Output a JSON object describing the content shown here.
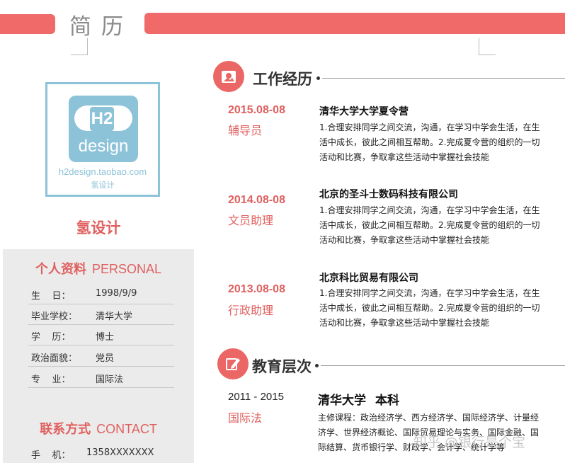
{
  "header": {
    "title": "简历"
  },
  "profile": {
    "logo": {
      "url_text": "h2design.taobao.com",
      "cn_text": "氢设计",
      "mark": "H2",
      "word": "design"
    },
    "name": "氢设计"
  },
  "personal": {
    "heading_cn": "个人资料",
    "heading_en": "PERSONAL",
    "rows": [
      {
        "label": "生    日：",
        "value": "1998/9/9"
      },
      {
        "label": "毕业学校：",
        "value": "清华大学"
      },
      {
        "label": "学    历：",
        "value": "博士"
      },
      {
        "label": "政治面貌：",
        "value": "党员"
      },
      {
        "label": "专    业：",
        "value": "国际法"
      }
    ]
  },
  "contact": {
    "heading_cn": "联系方式",
    "heading_en": "CONTACT",
    "rows": [
      {
        "label": "手    机：",
        "value": "1358XXXXXXX"
      }
    ]
  },
  "work": {
    "heading": "工作经历",
    "items": [
      {
        "date": "2015.08-08",
        "role": "辅导员",
        "company": "清华大学大学夏令营",
        "desc": "1.合理安排同学之间交流，沟通，在学习中学会生活，在生活中成长，彼此之间相互帮助。2.完成夏令营的组织的一切活动和比赛，争取拿这些活动中掌握社会技能"
      },
      {
        "date": "2014.08-08",
        "role": "文员助理",
        "company": "北京的圣斗士数码科技有限公司",
        "desc": "1.合理安排同学之间交流，沟通，在学习中学会生活，在生活中成长，彼此之间相互帮助。2.完成夏令营的组织的一切活动和比赛，争取拿这些活动中掌握社会技能"
      },
      {
        "date": "2013.08-08",
        "role": "行政助理",
        "company": "北京科比贸易有限公司",
        "desc": "1.合理安排同学之间交流，沟通，在学习中学会生活，在生活中成长，彼此之间相互帮助。2.完成夏令营的组织的一切活动和比赛，争取拿这些活动中掌握社会技能"
      }
    ]
  },
  "education": {
    "heading": "教育层次",
    "years": "2011 - 2015",
    "major": "国际法",
    "school": "清华大学",
    "degree": "本科",
    "desc": "主修课程：政治经济学、西方经济学、国际经济学、计量经济学、世界经济概论、国际贸易理论与实务、国际金融、国际结算、货币银行学、财政学、会计学、统计学等"
  },
  "watermark": "知乎 @银行是个宝",
  "colors": {
    "accent": "#f06a6a",
    "heading_red": "#e0605f",
    "logo_blue": "#8dc3d8",
    "panel_grey": "#ebebeb"
  },
  "icons": {
    "work": "briefcase-photo-icon",
    "education": "edit-pencil-icon"
  }
}
